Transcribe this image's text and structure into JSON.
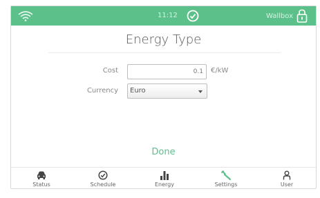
{
  "topbar": {
    "time": "11:12",
    "device_name": "Wallbox",
    "wifi_icon": "wifi-icon",
    "clock_icon": "clock-icon",
    "lock_icon": "lock-icon"
  },
  "page": {
    "title": "Energy Type"
  },
  "form": {
    "cost_label": "Cost",
    "cost_value": "0.1",
    "cost_unit": "€/kW",
    "currency_label": "Currency",
    "currency_selected": "Euro"
  },
  "actions": {
    "done_label": "Done"
  },
  "tabs": [
    {
      "label": "Status",
      "icon": "car-icon"
    },
    {
      "label": "Schedule",
      "icon": "clock-icon"
    },
    {
      "label": "Energy",
      "icon": "bar-chart-icon"
    },
    {
      "label": "Settings",
      "icon": "wrench-icon"
    },
    {
      "label": "User",
      "icon": "user-icon"
    }
  ],
  "colors": {
    "accent": "#5cc08a",
    "text": "#555555"
  }
}
